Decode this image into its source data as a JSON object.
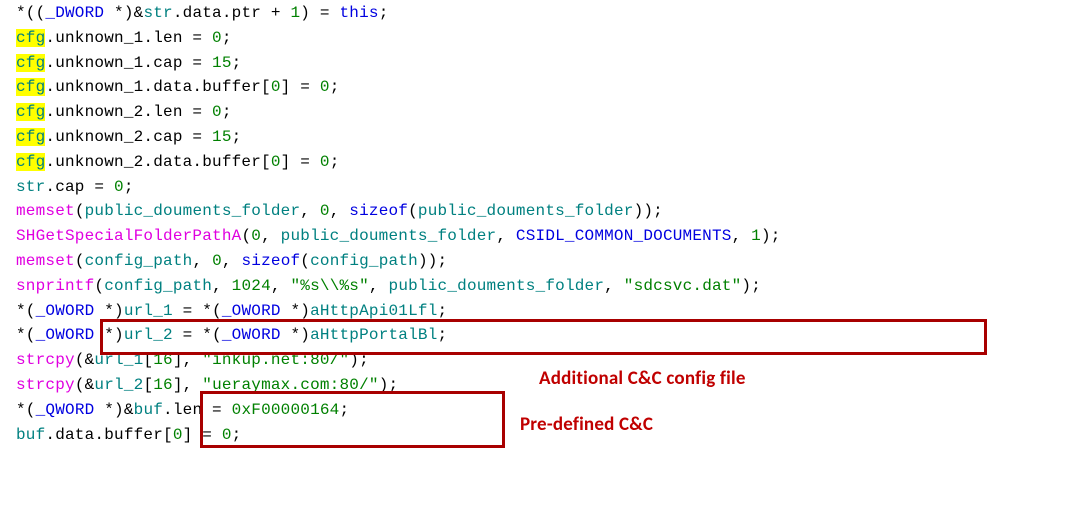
{
  "lines": [
    {
      "segments": [
        {
          "t": "*(("
        },
        {
          "t": "_DWORD",
          "cls": "type"
        },
        {
          "t": " *)&"
        },
        {
          "t": "str",
          "cls": "glob"
        },
        {
          "t": ".data.ptr + "
        },
        {
          "t": "1",
          "cls": "num"
        },
        {
          "t": ") = "
        },
        {
          "t": "this",
          "cls": "kw"
        },
        {
          "t": ";"
        }
      ]
    },
    {
      "segments": [
        {
          "t": "cfg",
          "cls": "glob",
          "hl": true
        },
        {
          "t": ".unknown_1.len = "
        },
        {
          "t": "0",
          "cls": "num"
        },
        {
          "t": ";"
        }
      ]
    },
    {
      "segments": [
        {
          "t": "cfg",
          "cls": "glob",
          "hl": true
        },
        {
          "t": ".unknown_1.cap = "
        },
        {
          "t": "15",
          "cls": "num"
        },
        {
          "t": ";"
        }
      ]
    },
    {
      "segments": [
        {
          "t": "cfg",
          "cls": "glob",
          "hl": true
        },
        {
          "t": ".unknown_1.data.buffer["
        },
        {
          "t": "0",
          "cls": "num"
        },
        {
          "t": "] = "
        },
        {
          "t": "0",
          "cls": "num"
        },
        {
          "t": ";"
        }
      ]
    },
    {
      "segments": [
        {
          "t": "cfg",
          "cls": "glob",
          "hl": true
        },
        {
          "t": ".unknown_2.len = "
        },
        {
          "t": "0",
          "cls": "num"
        },
        {
          "t": ";"
        }
      ]
    },
    {
      "segments": [
        {
          "t": "cfg",
          "cls": "glob",
          "hl": true
        },
        {
          "t": ".unknown_2.cap = "
        },
        {
          "t": "15",
          "cls": "num"
        },
        {
          "t": ";"
        }
      ]
    },
    {
      "segments": [
        {
          "t": "cfg",
          "cls": "glob",
          "hl": true
        },
        {
          "t": ".unknown_2.data.buffer["
        },
        {
          "t": "0",
          "cls": "num"
        },
        {
          "t": "] = "
        },
        {
          "t": "0",
          "cls": "num"
        },
        {
          "t": ";"
        }
      ]
    },
    {
      "segments": [
        {
          "t": "str",
          "cls": "glob"
        },
        {
          "t": ".cap = "
        },
        {
          "t": "0",
          "cls": "num"
        },
        {
          "t": ";"
        }
      ]
    },
    {
      "segments": [
        {
          "t": "memset",
          "cls": "fn"
        },
        {
          "t": "("
        },
        {
          "t": "public_douments_folder",
          "cls": "glob"
        },
        {
          "t": ", "
        },
        {
          "t": "0",
          "cls": "num"
        },
        {
          "t": ", "
        },
        {
          "t": "sizeof",
          "cls": "kw"
        },
        {
          "t": "("
        },
        {
          "t": "public_douments_folder",
          "cls": "glob"
        },
        {
          "t": "));"
        }
      ]
    },
    {
      "segments": [
        {
          "t": "SHGetSpecialFolderPathA",
          "cls": "fn"
        },
        {
          "t": "("
        },
        {
          "t": "0",
          "cls": "num"
        },
        {
          "t": ", "
        },
        {
          "t": "public_douments_folder",
          "cls": "glob"
        },
        {
          "t": ", "
        },
        {
          "t": "CSIDL_COMMON_DOCUMENTS",
          "cls": "type"
        },
        {
          "t": ", "
        },
        {
          "t": "1",
          "cls": "num"
        },
        {
          "t": ");"
        }
      ]
    },
    {
      "segments": [
        {
          "t": "memset",
          "cls": "fn"
        },
        {
          "t": "("
        },
        {
          "t": "config_path",
          "cls": "glob"
        },
        {
          "t": ", "
        },
        {
          "t": "0",
          "cls": "num"
        },
        {
          "t": ", "
        },
        {
          "t": "sizeof",
          "cls": "kw"
        },
        {
          "t": "("
        },
        {
          "t": "config_path",
          "cls": "glob"
        },
        {
          "t": "));"
        }
      ]
    },
    {
      "segments": [
        {
          "t": "snprintf",
          "cls": "fn"
        },
        {
          "t": "("
        },
        {
          "t": "config_path",
          "cls": "glob"
        },
        {
          "t": ", "
        },
        {
          "t": "1024",
          "cls": "num"
        },
        {
          "t": ", "
        },
        {
          "t": "\"%s\\\\%s\"",
          "cls": "str"
        },
        {
          "t": ", "
        },
        {
          "t": "public_douments_folder",
          "cls": "glob"
        },
        {
          "t": ", "
        },
        {
          "t": "\"sdcsvc.dat\"",
          "cls": "str"
        },
        {
          "t": ");"
        }
      ]
    },
    {
      "segments": [
        {
          "t": "*("
        },
        {
          "t": "_OWORD",
          "cls": "type"
        },
        {
          "t": " *)"
        },
        {
          "t": "url_1",
          "cls": "glob"
        },
        {
          "t": " = *("
        },
        {
          "t": "_OWORD",
          "cls": "type"
        },
        {
          "t": " *)"
        },
        {
          "t": "aHttpApi01Lfl",
          "cls": "glob"
        },
        {
          "t": ";"
        }
      ]
    },
    {
      "segments": [
        {
          "t": "*("
        },
        {
          "t": "_OWORD",
          "cls": "type"
        },
        {
          "t": " *)"
        },
        {
          "t": "url_2",
          "cls": "glob"
        },
        {
          "t": " = *("
        },
        {
          "t": "_OWORD",
          "cls": "type"
        },
        {
          "t": " *)"
        },
        {
          "t": "aHttpPortalBl",
          "cls": "glob"
        },
        {
          "t": ";"
        }
      ]
    },
    {
      "segments": [
        {
          "t": "strcpy",
          "cls": "fn"
        },
        {
          "t": "(&"
        },
        {
          "t": "url_1",
          "cls": "glob"
        },
        {
          "t": "["
        },
        {
          "t": "16",
          "cls": "num"
        },
        {
          "t": "], "
        },
        {
          "t": "\"inkup.net:80/\"",
          "cls": "str"
        },
        {
          "t": ");"
        }
      ]
    },
    {
      "segments": [
        {
          "t": "strcpy",
          "cls": "fn"
        },
        {
          "t": "(&"
        },
        {
          "t": "url_2",
          "cls": "glob"
        },
        {
          "t": "["
        },
        {
          "t": "16",
          "cls": "num"
        },
        {
          "t": "], "
        },
        {
          "t": "\"ueraymax.com:80/\"",
          "cls": "str"
        },
        {
          "t": ");"
        }
      ]
    },
    {
      "segments": [
        {
          "t": "*("
        },
        {
          "t": "_QWORD",
          "cls": "type"
        },
        {
          "t": " *)&"
        },
        {
          "t": "buf",
          "cls": "glob"
        },
        {
          "t": ".len = "
        },
        {
          "t": "0xF00000164",
          "cls": "num"
        },
        {
          "t": ";"
        }
      ]
    },
    {
      "segments": [
        {
          "t": "buf",
          "cls": "glob"
        },
        {
          "t": ".data.buffer["
        },
        {
          "t": "0",
          "cls": "num"
        },
        {
          "t": "] = "
        },
        {
          "t": "0",
          "cls": "num"
        },
        {
          "t": ";"
        }
      ]
    }
  ],
  "annotations": {
    "box1": {
      "label": "Additional C&C config file"
    },
    "box2": {
      "label": "Pre-defined C&C"
    }
  }
}
